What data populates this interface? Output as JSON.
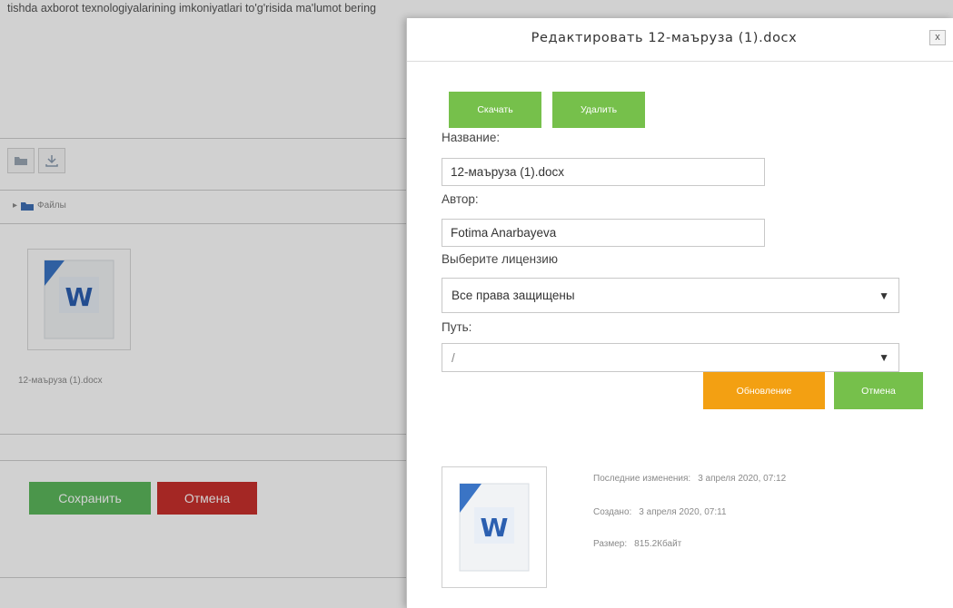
{
  "background": {
    "question_text": "tishda axborot texnologiyalarining imkoniyatlari to'g'risida ma'lumot bering",
    "breadcrumb_label": "Файлы",
    "file_name": "12-маъруза (1).docx",
    "save_label": "Сохранить",
    "cancel_label": "Отмена"
  },
  "modal": {
    "title": "Редактировать 12-маъруза (1).docx",
    "close_label": "x",
    "download_label": "Скачать",
    "delete_label": "Удалить",
    "name_label": "Название:",
    "name_value": "12-маъруза (1).docx",
    "author_label": "Автор:",
    "author_value": "Fotima Anarbayeva",
    "license_label": "Выберите лицензию",
    "license_value": "Все права защищены",
    "path_label": "Путь:",
    "path_value": "/",
    "update_label": "Обновление",
    "cancel_label": "Отмена",
    "meta": {
      "modified_label": "Последние изменения:",
      "modified_value": "3 апреля 2020, 07:12",
      "created_label": "Создано:",
      "created_value": "3 апреля 2020, 07:11",
      "size_label": "Размер:",
      "size_value": "815.2Кбайт"
    }
  },
  "colors": {
    "green": "#76c04b",
    "orange": "#f3a012",
    "bg_save": "#5cb85c",
    "bg_cancel": "#c9302c"
  },
  "icons": [
    "folder-icon",
    "download-icon",
    "word-document-icon",
    "close-icon",
    "dropdown-arrow-icon"
  ]
}
